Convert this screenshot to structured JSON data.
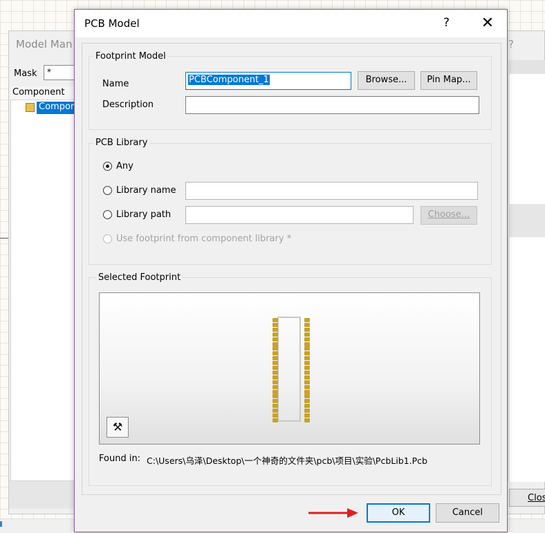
{
  "background_window": {
    "title": "Model Man",
    "help": "?",
    "mask_label": "Mask",
    "mask_value": "*",
    "column_header": "Component",
    "tree_item": "Compor",
    "close_button": "Clos"
  },
  "dialog": {
    "title": "PCB Model",
    "help_glyph": "?",
    "close_glyph": "✕",
    "footprint_model": {
      "legend": "Footprint Model",
      "name_label": "Name",
      "name_value": "PCBComponent_1",
      "description_label": "Description",
      "description_value": "",
      "browse_button": "Browse...",
      "pinmap_button": "Pin Map..."
    },
    "pcb_library": {
      "legend": "PCB Library",
      "options": [
        {
          "label": "Any",
          "checked": true,
          "enabled": true
        },
        {
          "label": "Library name",
          "checked": false,
          "enabled": true
        },
        {
          "label": "Library path",
          "checked": false,
          "enabled": true
        },
        {
          "label": "Use footprint from component library *",
          "checked": false,
          "enabled": false
        }
      ],
      "library_name_value": "",
      "library_path_value": "",
      "choose_button": "Choose..."
    },
    "selected_footprint": {
      "legend": "Selected Footprint",
      "found_in_label": "Found in:",
      "found_in_path": "C:\\Users\\乌泽\\Desktop\\一个神奇的文件夹\\pcb\\项目\\实验\\PcbLib1.Pcb"
    },
    "ok_button": "OK",
    "cancel_button": "Cancel"
  },
  "colors": {
    "selection": "#0078d7",
    "pad": "#c9a227",
    "arrow": "#e02020",
    "dialog_border": "#8d5b9c"
  }
}
